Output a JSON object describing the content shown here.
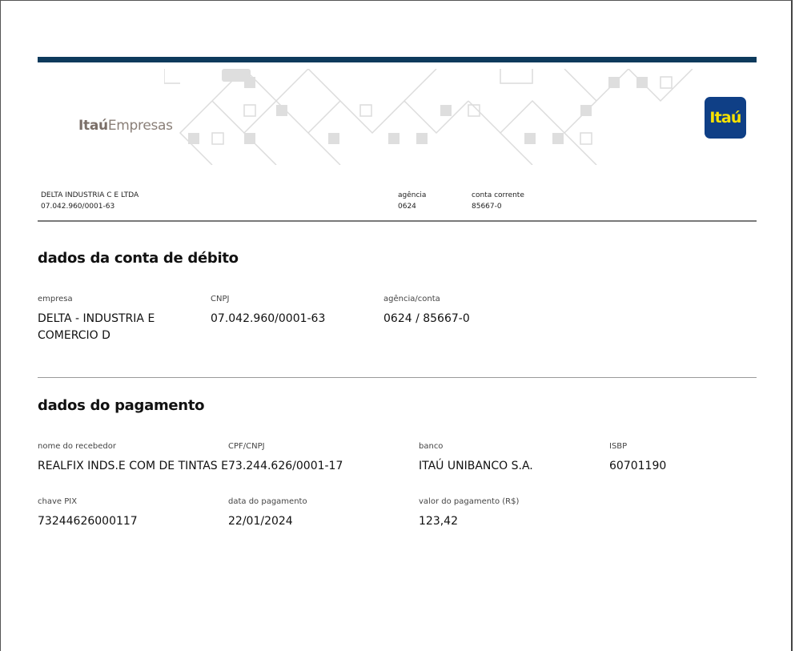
{
  "header": {
    "logo_strong": "Itaú",
    "logo_light": "Empresas",
    "badge_text": "Itaú",
    "company_name": "DELTA INDUSTRIA C E LTDA",
    "company_cnpj": "07.042.960/0001-63",
    "agencia_label": "agência",
    "agencia_value": "0624",
    "conta_label": "conta corrente",
    "conta_value": "85667-0"
  },
  "debit_section": {
    "title": "dados da conta de débito",
    "empresa_label": "empresa",
    "empresa_value": "DELTA - INDUSTRIA E COMERCIO D",
    "cnpj_label": "CNPJ",
    "cnpj_value": "07.042.960/0001-63",
    "agencia_conta_label": "agência/conta",
    "agencia_conta_value": "0624 / 85667-0"
  },
  "payment_section": {
    "title": "dados do pagamento",
    "recebedor_label": "nome do recebedor",
    "recebedor_value": "REALFIX INDS.E COM DE TINTAS E",
    "cpf_cnpj_label": "CPF/CNPJ",
    "cpf_cnpj_value": "73.244.626/0001-17",
    "banco_label": "banco",
    "banco_value": "ITAÚ UNIBANCO S.A.",
    "ispb_label": "ISBP",
    "ispb_value": "60701190",
    "chave_label": "chave PIX",
    "chave_value": "73244626000117",
    "data_label": "data do pagamento",
    "data_value": "22/01/2024",
    "valor_label": "valor do pagamento (R$)",
    "valor_value": "123,42"
  },
  "colors": {
    "top_bar": "#0d3a5c",
    "badge_bg": "#0f3f86",
    "badge_text": "#f7e200",
    "logo_text": "#8a7f78"
  }
}
